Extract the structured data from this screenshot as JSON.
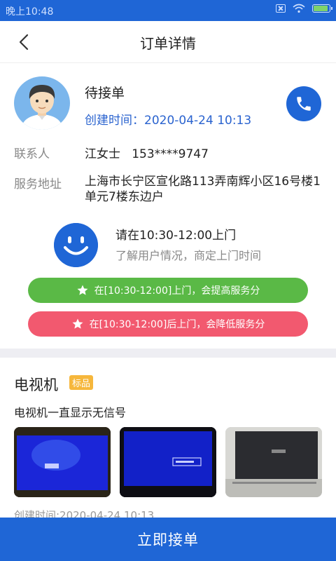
{
  "status_bar": {
    "time": "晚上10:48"
  },
  "nav": {
    "title": "订单详情"
  },
  "order": {
    "status": "待接单",
    "create_time_label": "创建时间：2020-04-24 10:13"
  },
  "contact": {
    "label": "联系人",
    "name_phone": "江女士   153****9747"
  },
  "address": {
    "label": "服务地址",
    "value": "上海市长宁区宣化路113弄南辉小区16号楼1单元7楼东边户"
  },
  "visit": {
    "time_text": "请在10:30-12:00上门",
    "hint": "了解用户情况，商定上门时间"
  },
  "notices": {
    "good": "在[10:30-12:00]上门，会提高服务分",
    "bad": "在[10:30-12:00]后上门，会降低服务分"
  },
  "device": {
    "name": "电视机",
    "badge": "标品",
    "fault": "电视机一直显示无信号",
    "created": "创建时间:2020-04-24 10:13"
  },
  "actions": {
    "accept": "立即接单"
  },
  "colors": {
    "primary": "#1f66d6",
    "green": "#5ab946",
    "red": "#f2596f",
    "badge": "#f6b73c"
  }
}
